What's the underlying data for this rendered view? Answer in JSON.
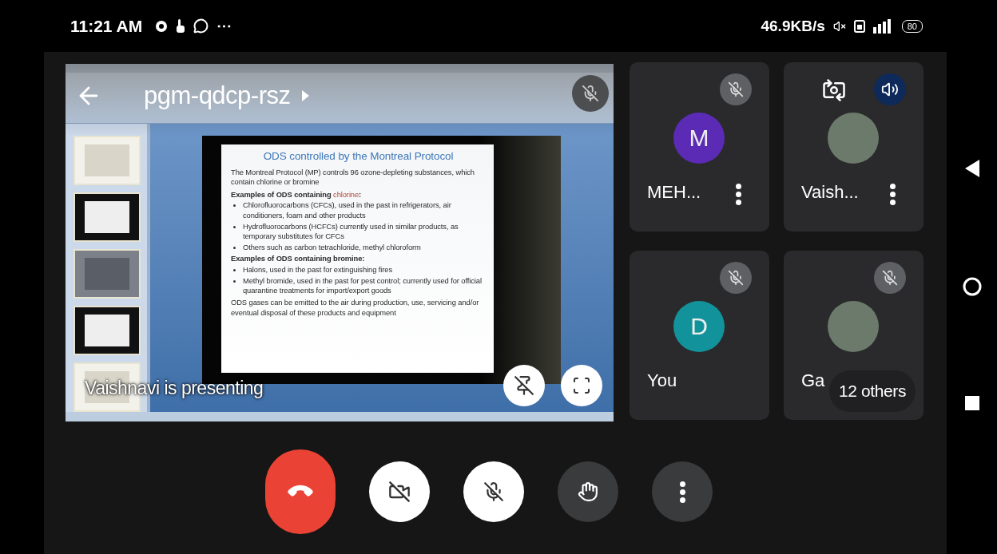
{
  "status_bar": {
    "time": "11:21 AM",
    "more": "⋯",
    "speed": "46.9KB/s",
    "battery": "80"
  },
  "presentation": {
    "meeting_code": "pgm-qdcp-rsz",
    "caption": "Vaishnavi is presenting",
    "mic_muted": true,
    "thumbnails": [
      {
        "kind": "light"
      },
      {
        "kind": "dark"
      },
      {
        "kind": "grey"
      },
      {
        "kind": "dark"
      },
      {
        "kind": "light"
      }
    ],
    "slide": {
      "title": "ODS controlled by the Montreal Protocol",
      "intro": "The Montreal Protocol (MP) controls 96 ozone-depleting substances, which contain chlorine or bromine",
      "sections": [
        {
          "heading": [
            {
              "text": "Examples of ODS containing ",
              "highlight": false
            },
            {
              "text": "chlorine",
              "highlight": true
            },
            {
              "text": ":",
              "highlight": false
            }
          ],
          "bullets": [
            "Chlorofluorocarbons (CFCs), used in the past in refrigerators, air conditioners, foam and other products",
            "Hydrofluorocarbons (HCFCs) currently used in similar products, as temporary substitutes for CFCs",
            "Others such as carbon tetrachloride,  methyl chloroform"
          ]
        },
        {
          "heading": [
            {
              "text": "Examples of ODS containing bromine",
              "highlight": false
            },
            {
              "text": ":",
              "highlight": false
            }
          ],
          "bullets": [
            "Halons, used in the past for extinguishing fires",
            "Methyl bromide, used in the past for pest control; currently used for official quarantine treatments for import/export goods"
          ]
        }
      ],
      "footer": "ODS gases can be emitted to the air during production, use, servicing and/or eventual disposal of these products and equipment"
    }
  },
  "tiles": [
    {
      "name": "MEH...",
      "initial": "M",
      "color": "#5b2bb5",
      "muted": true,
      "menu": true,
      "camera_switch": false
    },
    {
      "name": "Vaish...",
      "muted": false,
      "menu": true,
      "camera_switch": true
    },
    {
      "name": "You",
      "initial": "D",
      "color": "#12939c",
      "muted": true,
      "menu": false,
      "camera_switch": false
    },
    {
      "name": "Ga",
      "muted": true,
      "menu": false,
      "camera_switch": false
    }
  ],
  "others": "12 others",
  "controls": [
    {
      "kind": "end-call"
    },
    {
      "kind": "camera-off"
    },
    {
      "kind": "mic-off"
    },
    {
      "kind": "raise-hand"
    },
    {
      "kind": "more"
    }
  ]
}
